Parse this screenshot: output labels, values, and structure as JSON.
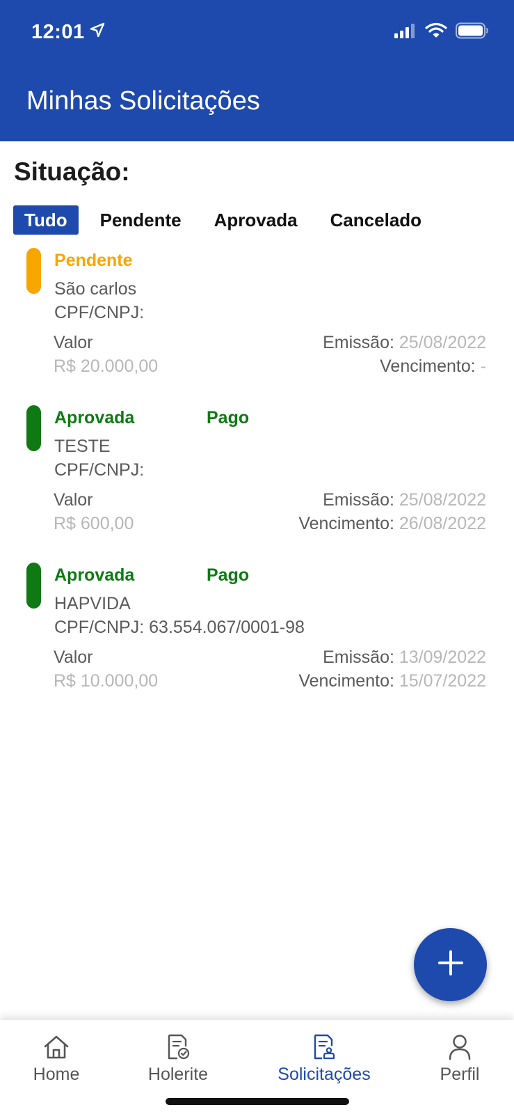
{
  "status_bar": {
    "time": "12:01",
    "icons": [
      "location-arrow-icon",
      "signal-icon",
      "wifi-icon",
      "battery-icon"
    ]
  },
  "header": {
    "title": "Minhas Solicitações",
    "background": "#1e4aad"
  },
  "filter": {
    "title": "Situação:",
    "options": [
      "Tudo",
      "Pendente",
      "Aprovada",
      "Cancelado"
    ],
    "selected": "Tudo"
  },
  "labels": {
    "doc": "CPF/CNPJ:",
    "valor": "Valor",
    "emissao": "Emissão:",
    "vencimento": "Vencimento:"
  },
  "requests": [
    {
      "status": "Pendente",
      "status_color": "#f7a600",
      "payment": "",
      "name": "São carlos",
      "doc_number": "",
      "valor": "R$ 20.000,00",
      "emissao": "25/08/2022",
      "vencimento": "-"
    },
    {
      "status": "Aprovada",
      "status_color": "#0f7a14",
      "payment": "Pago",
      "name": "TESTE",
      "doc_number": "",
      "valor": "R$ 600,00",
      "emissao": "25/08/2022",
      "vencimento": "26/08/2022"
    },
    {
      "status": "Aprovada",
      "status_color": "#0f7a14",
      "payment": "Pago",
      "name": "HAPVIDA",
      "doc_number": "63.554.067/0001-98",
      "valor": "R$ 10.000,00",
      "emissao": "13/09/2022",
      "vencimento": "15/07/2022"
    }
  ],
  "fab": {
    "icon": "plus-icon"
  },
  "tabbar": {
    "items": [
      {
        "label": "Home",
        "icon": "home-icon"
      },
      {
        "label": "Holerite",
        "icon": "payslip-icon"
      },
      {
        "label": "Solicitações",
        "icon": "requests-icon"
      },
      {
        "label": "Perfil",
        "icon": "profile-icon"
      }
    ],
    "active": "Solicitações",
    "active_color": "#1e4aad"
  }
}
